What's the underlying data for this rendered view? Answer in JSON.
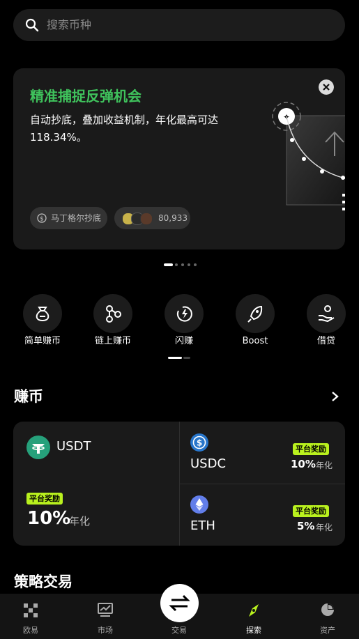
{
  "search": {
    "placeholder": "搜索币种"
  },
  "banner": {
    "title": "精准捕捉反弹机会",
    "description": "自动抄底，叠加收益机制，年化最高可达118.34%。",
    "chip_strategy": "马丁格尔抄底",
    "chip_count": "80,933",
    "colors": {
      "title": "#3fc25c"
    }
  },
  "quick_actions": [
    {
      "label": "简单赚币",
      "icon": "money-bag-icon"
    },
    {
      "label": "链上赚币",
      "icon": "chain-nodes-icon"
    },
    {
      "label": "闪赚",
      "icon": "flash-timer-icon"
    },
    {
      "label": "Boost",
      "icon": "rocket-icon"
    },
    {
      "label": "借贷",
      "icon": "hand-coin-icon"
    }
  ],
  "earn": {
    "title": "赚币",
    "usdt": {
      "name": "USDT",
      "badge": "平台奖励",
      "rate": "10%",
      "suffix": "年化"
    },
    "usdc": {
      "name": "USDC",
      "badge": "平台奖励",
      "rate": "10%",
      "suffix": "年化"
    },
    "eth": {
      "name": "ETH",
      "badge": "平台奖励",
      "rate": "5%",
      "suffix": "年化"
    },
    "colors": {
      "badge": "#b9f11e",
      "usdt": "#26a17b",
      "usdc": "#2775ca",
      "eth": "#627eea"
    }
  },
  "strategy": {
    "title": "策略交易"
  },
  "nav": {
    "items": [
      {
        "label": "欧易",
        "icon": "okx-logo-icon"
      },
      {
        "label": "市场",
        "icon": "chart-icon"
      },
      {
        "label": "交易",
        "icon": "swap-icon"
      },
      {
        "label": "探索",
        "icon": "compass-icon"
      },
      {
        "label": "资产",
        "icon": "pie-chart-icon"
      }
    ],
    "active": "探索",
    "colors": {
      "active": "#b9f11e"
    }
  }
}
